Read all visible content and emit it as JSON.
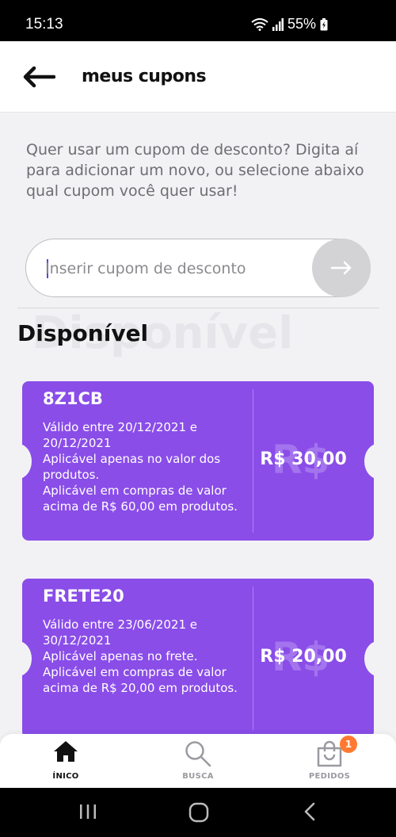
{
  "status_bar": {
    "time": "15:13",
    "battery": "55%"
  },
  "header": {
    "title": "meus cupons"
  },
  "intro_text": "Quer usar um cupom de desconto? Digita aí para adicionar um novo, ou selecione abaixo qual cupom você quer usar!",
  "coupon_input": {
    "placeholder": "Inserir cupom de desconto",
    "value": ""
  },
  "section": {
    "title": "Disponível",
    "ghost_title": "Disponível"
  },
  "coupons": [
    {
      "code": "8Z1CB",
      "validity": "Válido entre 20/12/2021 e 20/12/2021",
      "applies_to": "Aplicável apenas no valor dos produtos.",
      "minimum": "Aplicável em compras de valor acima de R$ 60,00 em produtos.",
      "value": "R$ 30,00",
      "currency_ghost": "R$"
    },
    {
      "code": "FRETE20",
      "validity": "Válido entre 23/06/2021 e 30/12/2021",
      "applies_to": "Aplicável apenas no frete.",
      "minimum": "Aplicável em compras de valor acima de R$ 20,00 em produtos.",
      "value": "R$ 20,00",
      "currency_ghost": "R$"
    }
  ],
  "bottom_nav": {
    "home": "ÍNICO",
    "search": "BUSCA",
    "orders": "PEDIDOS",
    "orders_badge": "1"
  },
  "colors": {
    "accent": "#8a4de8",
    "badge": "#ff7a30",
    "background": "#f2f2f4"
  },
  "icons": [
    "back-arrow-icon",
    "arrow-right-icon",
    "home-icon",
    "search-icon",
    "shopping-bag-icon",
    "wifi-icon",
    "signal-icon",
    "battery-icon",
    "recents-icon",
    "home-circle-icon",
    "back-chevron-icon"
  ]
}
